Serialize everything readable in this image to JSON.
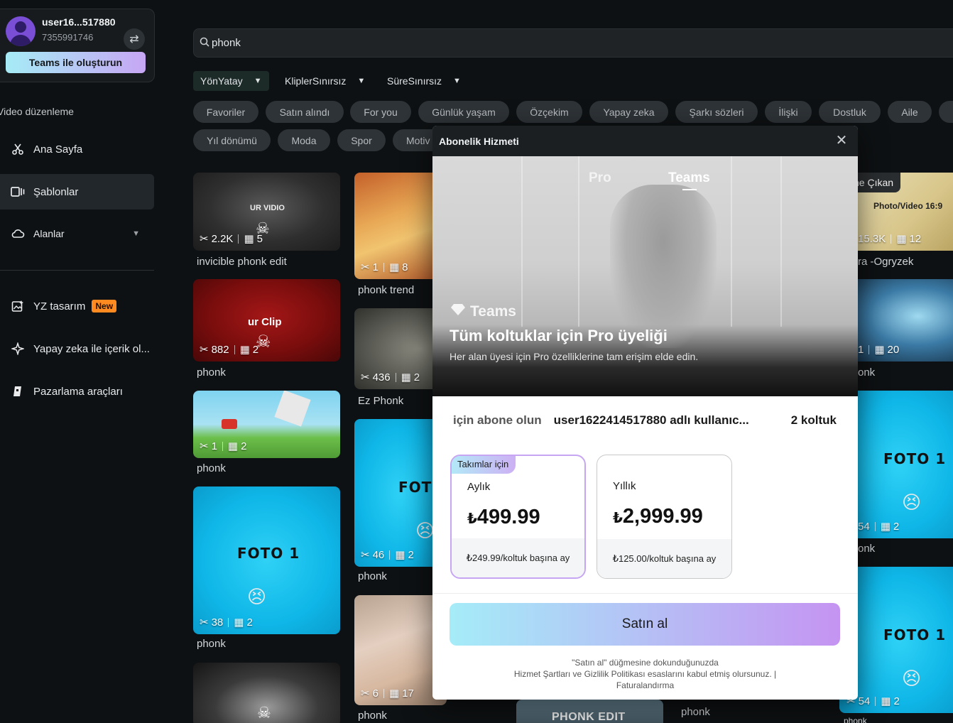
{
  "sidebar": {
    "account": {
      "name": "user16...517880",
      "id": "7355991746",
      "teams_button": "Teams ile oluşturun"
    },
    "section_label": "Video düzenleme",
    "items": [
      {
        "label": "Ana Sayfa"
      },
      {
        "label": "Şablonlar"
      },
      {
        "label": "Alanlar"
      }
    ],
    "tools": [
      {
        "label": "YZ tasarım",
        "badge": "New"
      },
      {
        "label": "Yapay zeka ile içerik ol..."
      },
      {
        "label": "Pazarlama araçları"
      }
    ]
  },
  "search": {
    "query": "phonk"
  },
  "filters": [
    {
      "label": "YönYatay"
    },
    {
      "label": "KliplerSınırsız"
    },
    {
      "label": "SüreSınırsız"
    }
  ],
  "chips_row1": [
    "Favoriler",
    "Satın alındı",
    "For you",
    "Günlük yaşam",
    "Özçekim",
    "Yapay zeka",
    "Şarkı sözleri",
    "İlişki",
    "Dostluk",
    "Aile"
  ],
  "chips_row2": [
    "Yıl dönümü",
    "Moda",
    "Spor",
    "Motiv"
  ],
  "cards": {
    "c1": {
      "uses": "2.2K",
      "clips": "5",
      "title": "invicible phonk edit",
      "overlay": "UR VIDIO"
    },
    "c2": {
      "uses": "882",
      "clips": "2",
      "title": "phonk",
      "overlay": "ur Clip"
    },
    "c3": {
      "uses": "1",
      "clips": "2",
      "title": "phonk"
    },
    "c4": {
      "uses": "38",
      "clips": "2",
      "title": "phonk",
      "overlay": "FOTO 1"
    },
    "c5": {
      "uses": "1",
      "clips": "8",
      "title": "phonk trend"
    },
    "c6": {
      "uses": "436",
      "clips": "2",
      "title": "Ez Phonk"
    },
    "c7": {
      "uses": "46",
      "clips": "2",
      "title": "phonk",
      "overlay": "FOTO"
    },
    "c8": {
      "uses": "6",
      "clips": "17",
      "title": "phonk"
    },
    "c9": {
      "overlay": "PHONK EDIT"
    },
    "c10": {
      "title": "phonk"
    },
    "r1": {
      "uses": "15.3K",
      "clips": "12",
      "title": "ra -Ogryzek",
      "badge": "ne Çıkan",
      "overlay": "Photo/Video 16:9"
    },
    "r2": {
      "uses": "1",
      "clips": "20",
      "title": "onk"
    },
    "r3": {
      "uses": "54",
      "clips": "2",
      "title": "onk",
      "overlay": "FOTO 1"
    },
    "r4": {
      "uses": "54",
      "clips": "2",
      "overlay": "FOTO 1",
      "title": "phonk"
    }
  },
  "modal": {
    "title": "Abonelik Hizmeti",
    "tabs": [
      "Pro",
      "Teams"
    ],
    "brand": "Teams",
    "headline": "Tüm koltuklar için Pro üyeliği",
    "subtitle": "Her alan üyesi için Pro özelliklerine tam erişim elde edin.",
    "subscribe_label": "için abone olun",
    "account": "user1622414517880 adlı kullanıc...",
    "seats": "2 koltuk",
    "plans": [
      {
        "tag": "Takımlar için",
        "name": "Aylık",
        "currency": "₺",
        "price": "499.99",
        "per_seat": "₺249.99/koltuk başına ay"
      },
      {
        "name": "Yıllık",
        "currency": "₺",
        "price": "2,999.99",
        "per_seat": "₺125.00/koltuk başına ay"
      }
    ],
    "buy": "Satın al",
    "legal_1": "\"Satın al\" düğmesine dokunduğunuzda",
    "legal_2": "Hizmet Şartları ve Gizlilik Politikası esaslarını kabul etmiş olursunuz. |",
    "legal_3": "Faturalandırma"
  },
  "colors": {
    "accent_gradient_start": "#a6ecf6",
    "accent_gradient_end": "#c594f2",
    "badge": "#ff8a1f",
    "background": "#0e1113"
  }
}
